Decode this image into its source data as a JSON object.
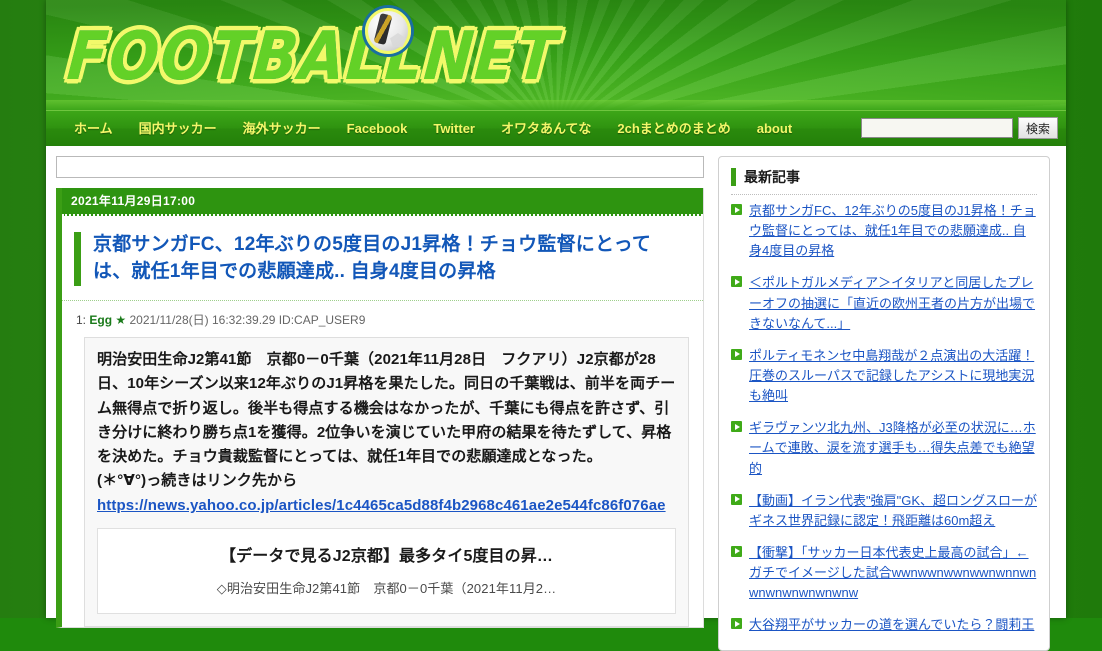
{
  "site": {
    "logo_text": "FOOTBALLNET",
    "logo_ball_icon": "soccer-ball-icon"
  },
  "nav": {
    "items": [
      {
        "label": "ホーム"
      },
      {
        "label": "国内サッカー"
      },
      {
        "label": "海外サッカー"
      },
      {
        "label": "Facebook"
      },
      {
        "label": "Twitter"
      },
      {
        "label": "オワタあんてな"
      },
      {
        "label": "2chまとめのまとめ"
      },
      {
        "label": "about"
      }
    ],
    "search": {
      "value": "",
      "placeholder": "",
      "button_label": "検索"
    }
  },
  "main": {
    "top_box": {
      "value": "",
      "placeholder": ""
    },
    "article": {
      "date": "2021年11月29日17:00",
      "title": "京都サンガFC、12年ぶりの5度目のJ1昇格！チョウ監督にとっては、就任1年目での悲願達成.. 自身4度目の昇格",
      "post": {
        "number": "1:",
        "name": "Egg",
        "star": "★",
        "rest": "2021/11/28(日) 16:32:39.29 ID:CAP_USER9"
      },
      "body_lines": [
        "明治安田生命J2第41節　京都0－0千葉（2021年11月28日　フクアリ）J2京都が28日、10年シーズン以来12年ぶりのJ1昇格を果たした。同日の千葉戦は、前半を両チーム無得点で折り返し。後半も得点する機会はなかったが、千葉にも得点を許さず、引き分けに終わり勝ち点1を獲得。2位争いを演じていた甲府の結果を待たずして、昇格を決めた。チョウ貴裁監督にとっては、就任1年目での悲願達成となった。",
        "(＊°∀°)っ続きはリンク先から"
      ],
      "link_url": "https://news.yahoo.co.jp/articles/1c4465ca5d88f4b2968c461ae2e544fc86f076ae",
      "embed": {
        "title": "【データで見るJ2京都】最多タイ5度目の昇…",
        "description": "◇明治安田生命J2第41節　京都0－0千葉（2021年11月2…"
      }
    }
  },
  "sidebar": {
    "heading": "最新記事",
    "items": [
      {
        "label": "京都サンガFC、12年ぶりの5度目のJ1昇格！チョウ監督にとっては、就任1年目での悲願達成.. 自身4度目の昇格"
      },
      {
        "label": "＜ポルトガルメディア＞イタリアと同居したプレーオフの抽選に「直近の欧州王者の片方が出場できないなんて...」"
      },
      {
        "label": "ポルティモネンセ中島翔哉が２点演出の大活躍！圧巻のスルーパスで記録したアシストに現地実況も絶叫"
      },
      {
        "label": "ギラヴァンツ北九州、J3降格が必至の状況に…ホームで連敗、涙を流す選手も…得失点差でも絶望的"
      },
      {
        "label": "【動画】イラン代表\"強肩\"GK、超ロングスローがギネス世界記録に認定！飛距離は60m超え"
      },
      {
        "label": "【衝撃】「サッカー日本代表史上最高の試合」←ガチでイメージした試合wwnwwnwwnwwnwnnwnwnwnwnwnwnwnw"
      },
      {
        "label": "大谷翔平がサッカーの道を選んでいたら？闘莉王"
      }
    ]
  },
  "colors": {
    "brand_green": "#2e9410",
    "accent_green": "#3b9e15",
    "nav_text": "#f4f76a",
    "link_blue": "#1b55c4",
    "title_blue": "#1257b8"
  }
}
